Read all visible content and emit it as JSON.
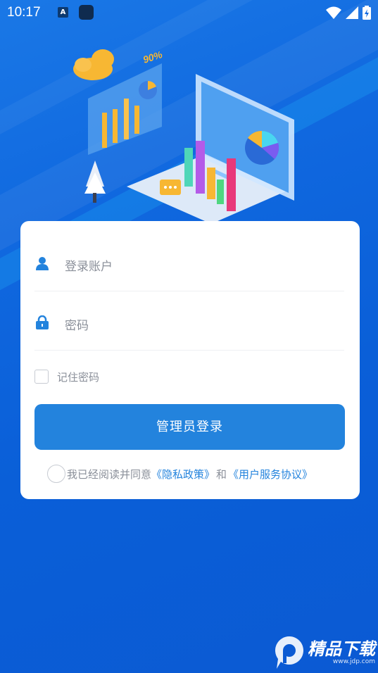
{
  "status_bar": {
    "time": "10:17",
    "notif_letter": "A"
  },
  "form": {
    "username_placeholder": "登录账户",
    "password_placeholder": "密码",
    "remember_label": "记住密码",
    "login_button": "管理员登录"
  },
  "agreement": {
    "prefix": "我已经阅读并同意",
    "privacy_link": "《隐私政策》",
    "conjunction": "和",
    "terms_link": "《用户服务协议》"
  },
  "illustration": {
    "percent_label": "90%"
  },
  "watermark": {
    "text": "精品下载",
    "url": "www.jdp.com"
  },
  "colors": {
    "primary": "#2383dd",
    "background": "#0b5ad3",
    "card": "#ffffff"
  }
}
